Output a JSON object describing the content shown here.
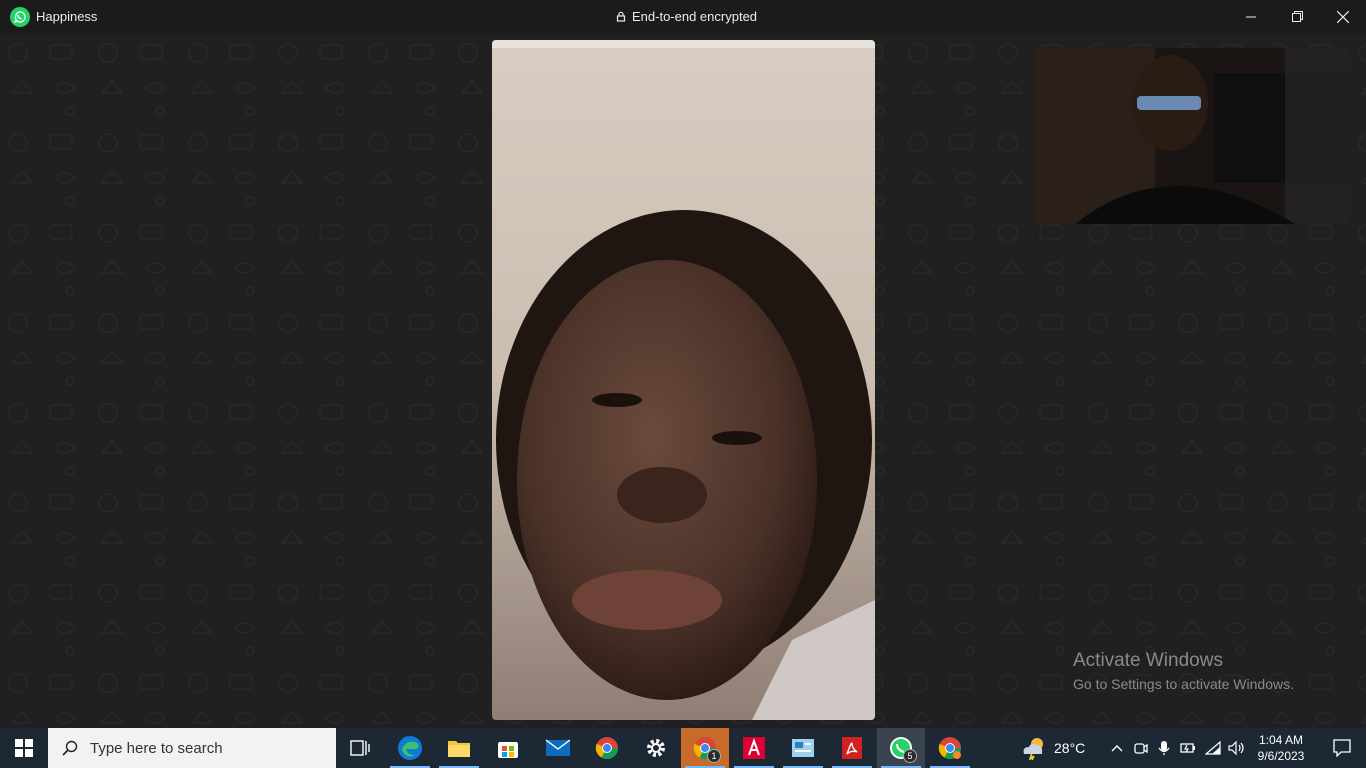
{
  "window": {
    "title": "Happiness",
    "status": "End-to-end encrypted"
  },
  "call": {
    "remote_participant": "Happiness"
  },
  "watermark": {
    "title": "Activate Windows",
    "subtitle": "Go to Settings to activate Windows."
  },
  "taskbar": {
    "search_placeholder": "Type here to search",
    "apps": [
      {
        "name": "task-view-icon"
      },
      {
        "name": "edge-icon"
      },
      {
        "name": "file-explorer-icon"
      },
      {
        "name": "microsoft-store-icon"
      },
      {
        "name": "mail-icon"
      },
      {
        "name": "chrome-icon"
      },
      {
        "name": "settings-icon"
      },
      {
        "name": "chrome-profile-icon",
        "badge": "1"
      },
      {
        "name": "angular-icon"
      },
      {
        "name": "control-panel-icon"
      },
      {
        "name": "adobe-reader-icon"
      },
      {
        "name": "whatsapp-icon",
        "badge": "5"
      },
      {
        "name": "chrome-profile-2-icon"
      }
    ],
    "weather": "28°C",
    "time": "1:04 AM",
    "date": "9/6/2023"
  },
  "colors": {
    "taskbar": "#1c2833",
    "titlebar": "#1b1b1b",
    "call_bg": "#202020",
    "whatsapp_green": "#25d366"
  }
}
